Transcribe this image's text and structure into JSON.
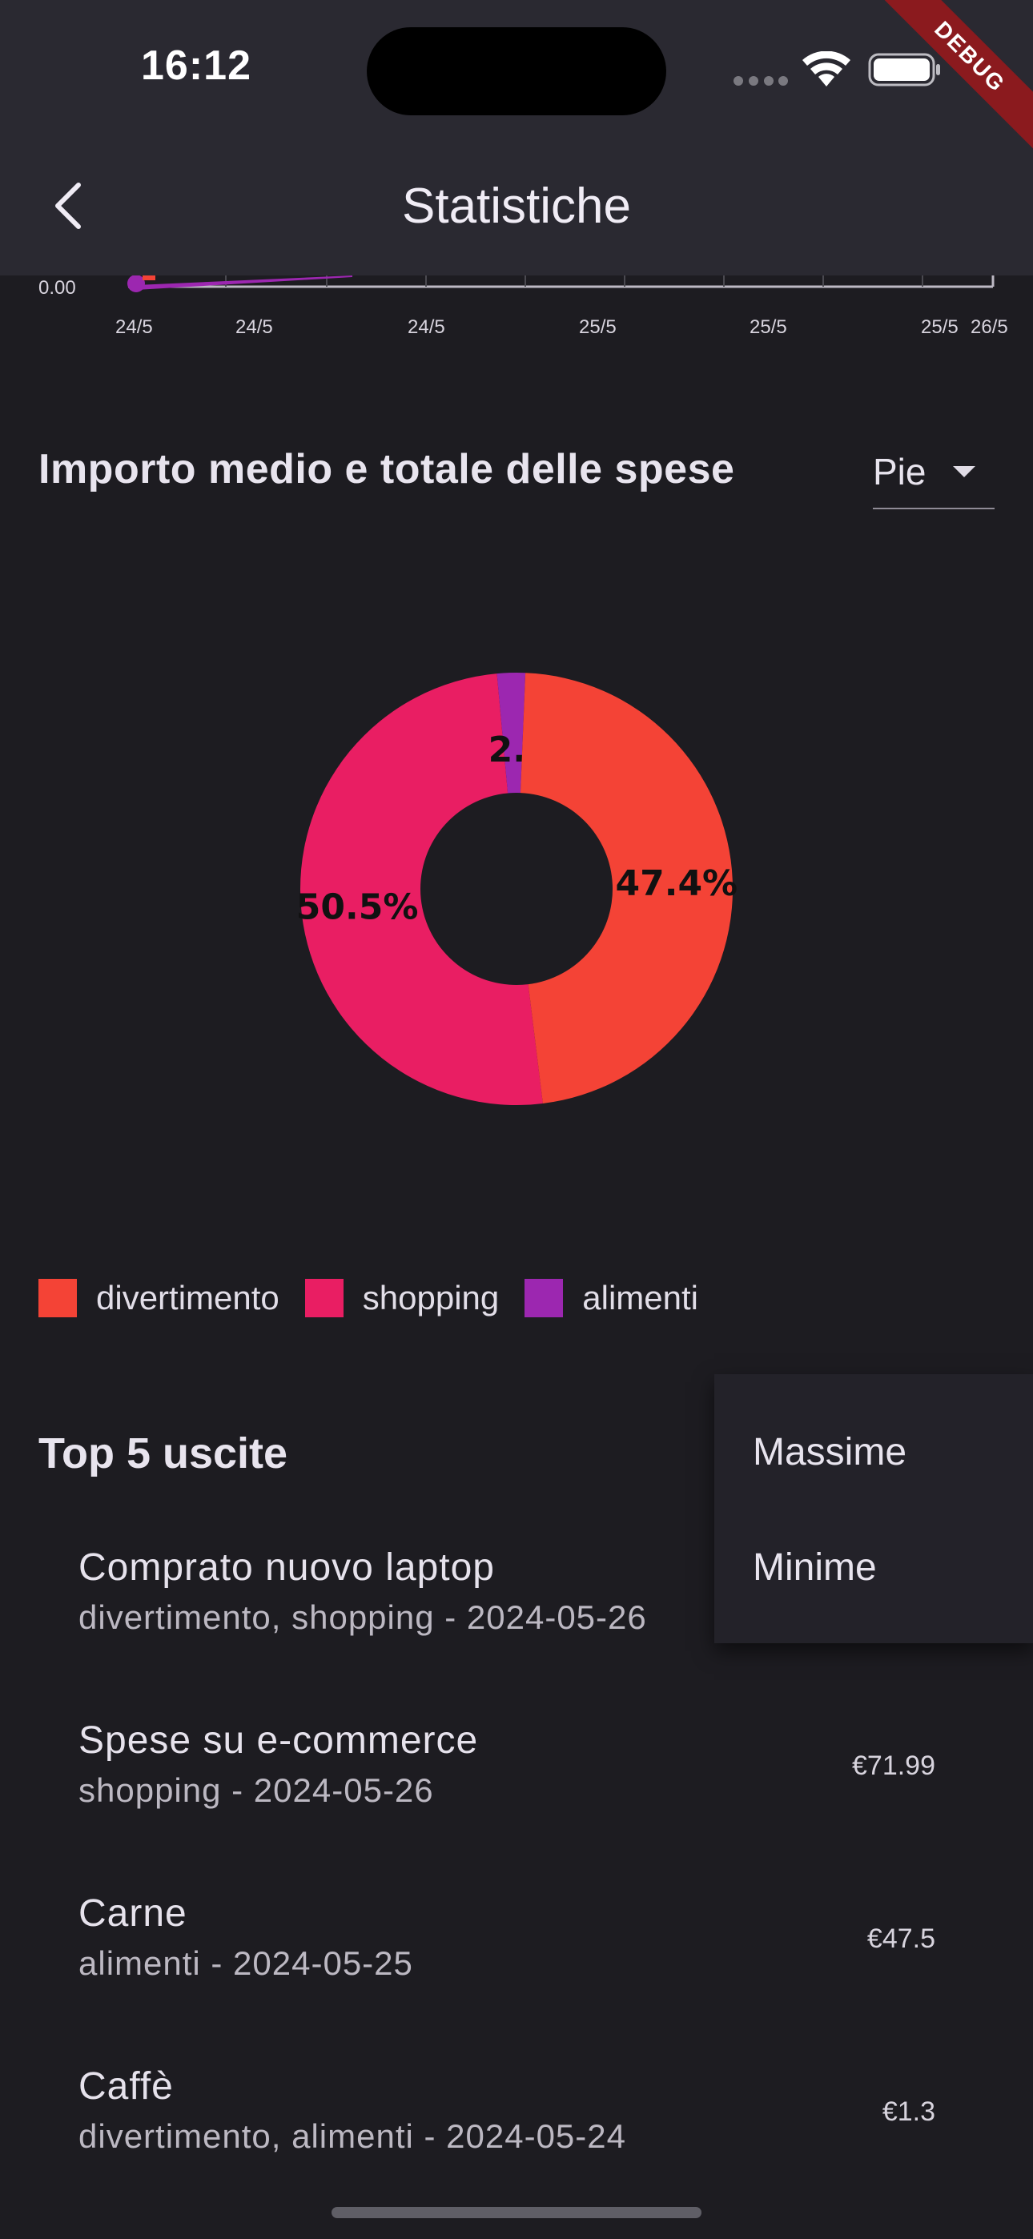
{
  "status_bar": {
    "time": "16:12"
  },
  "debug_banner": "DEBUG",
  "app_bar": {
    "title": "Statistiche"
  },
  "line_chart_partial": {
    "y_tick": "0.00",
    "x_ticks": [
      "24/5",
      "24/5",
      "24/5",
      "25/5",
      "25/5",
      "25/5",
      "26/5"
    ]
  },
  "pie_section": {
    "title": "Importo medio e totale delle spese",
    "chart_type_selected": "Pie"
  },
  "chart_data": {
    "type": "pie",
    "donut": true,
    "labels": [
      "divertimento",
      "shopping",
      "alimenti"
    ],
    "values": [
      47.4,
      50.5,
      2.1
    ],
    "value_labels": [
      "47.4%",
      "50.5%",
      "2.1%"
    ],
    "colors": [
      "#f44336",
      "#e91e63",
      "#9c27b0"
    ],
    "legend_position": "bottom-left"
  },
  "legend": [
    {
      "label": "divertimento",
      "color": "#f44336"
    },
    {
      "label": "shopping",
      "color": "#e91e63"
    },
    {
      "label": "alimenti",
      "color": "#9c27b0"
    }
  ],
  "top5": {
    "title": "Top 5 uscite",
    "items": [
      {
        "title": "Comprato nuovo laptop",
        "subtitle": "divertimento, shopping - 2024-05-26",
        "amount": ""
      },
      {
        "title": "Spese su e-commerce",
        "subtitle": "shopping - 2024-05-26",
        "amount": "€71.99"
      },
      {
        "title": "Carne",
        "subtitle": "alimenti - 2024-05-25",
        "amount": "€47.5"
      },
      {
        "title": "Caffè",
        "subtitle": "divertimento, alimenti - 2024-05-24",
        "amount": "€1.3"
      }
    ]
  },
  "sort_menu": {
    "options": [
      "Massime",
      "Minime"
    ]
  }
}
